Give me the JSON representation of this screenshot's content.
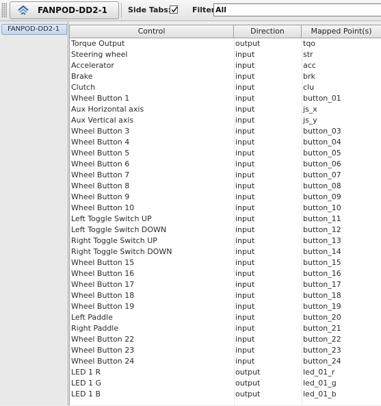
{
  "toolbar": {
    "device_button_label": "FANPOD-DD2-1",
    "side_tabs_label": "Side Tabs:",
    "side_tabs_checked": true,
    "filter_label": "Filter:",
    "filter_value": "All"
  },
  "sidebar": {
    "tabs": [
      {
        "label": "FANPOD-DD2-1"
      }
    ]
  },
  "table": {
    "columns": [
      "Control",
      "Direction",
      "Mapped Point(s)"
    ],
    "rows": [
      [
        "Torque Output",
        "output",
        "tqo"
      ],
      [
        "Steering wheel",
        "input",
        "str"
      ],
      [
        "Accelerator",
        "input",
        "acc"
      ],
      [
        "Brake",
        "input",
        "brk"
      ],
      [
        "Clutch",
        "input",
        "clu"
      ],
      [
        "Wheel Button 1",
        "input",
        "button_01"
      ],
      [
        "Aux Horizontal axis",
        "input",
        "js_x"
      ],
      [
        "Aux Vertical axis",
        "input",
        "js_y"
      ],
      [
        "Wheel Button 3",
        "input",
        "button_03"
      ],
      [
        "Wheel Button 4",
        "input",
        "button_04"
      ],
      [
        "Wheel Button 5",
        "input",
        "button_05"
      ],
      [
        "Wheel Button 6",
        "input",
        "button_06"
      ],
      [
        "Wheel Button 7",
        "input",
        "button_07"
      ],
      [
        "Wheel Button 8",
        "input",
        "button_08"
      ],
      [
        "Wheel Button 9",
        "input",
        "button_09"
      ],
      [
        "Wheel Button 10",
        "input",
        "button_10"
      ],
      [
        "Left Toggle Switch UP",
        "input",
        "button_11"
      ],
      [
        "Left Toggle Switch DOWN",
        "input",
        "button_12"
      ],
      [
        "Right Toggle Switch UP",
        "input",
        "button_13"
      ],
      [
        "Right Toggle Switch DOWN",
        "input",
        "button_14"
      ],
      [
        "Wheel Button 15",
        "input",
        "button_15"
      ],
      [
        "Wheel Button 16",
        "input",
        "button_16"
      ],
      [
        "Wheel Button 17",
        "input",
        "button_17"
      ],
      [
        "Wheel Button 18",
        "input",
        "button_18"
      ],
      [
        "Wheel Button 19",
        "input",
        "button_19"
      ],
      [
        "Left Paddle",
        "input",
        "button_20"
      ],
      [
        "Right Paddle",
        "input",
        "button_21"
      ],
      [
        "Wheel Button 22",
        "input",
        "button_22"
      ],
      [
        "Wheel Button 23",
        "input",
        "button_23"
      ],
      [
        "Wheel Button 24",
        "input",
        "button_24"
      ],
      [
        "LED 1 R",
        "output",
        "led_01_r"
      ],
      [
        "LED 1 G",
        "output",
        "led_01_g"
      ],
      [
        "LED 1 B",
        "output",
        "led_01_b"
      ]
    ]
  },
  "icons": {
    "device": "device-cycle-icon",
    "checkbox": "checkmark-icon"
  },
  "colors": {
    "tab_selected": "#c3d5ea",
    "device_icon": "#3b6ea5"
  }
}
